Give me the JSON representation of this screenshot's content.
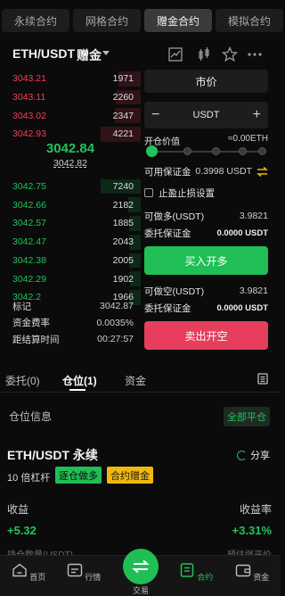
{
  "top_tabs": [
    "永续合约",
    "网格合约",
    "赠金合约",
    "模拟合约"
  ],
  "header": {
    "pair": "ETH/USDT",
    "badge": "赠金"
  },
  "orderbook": {
    "asks": [
      {
        "price": "3043.21",
        "qty": "1971",
        "depth": 0.55
      },
      {
        "price": "3043.11",
        "qty": "2260",
        "depth": 0.62
      },
      {
        "price": "3043.02",
        "qty": "2347",
        "depth": 0.65
      },
      {
        "price": "3042.93",
        "qty": "4221",
        "depth": 1.0
      }
    ],
    "mid": {
      "price": "3042.84",
      "mark": "3042.82"
    },
    "bids": [
      {
        "price": "3042.75",
        "qty": "7240",
        "depth": 1.0
      },
      {
        "price": "3042.66",
        "qty": "2182",
        "depth": 0.32
      },
      {
        "price": "3042.57",
        "qty": "1885",
        "depth": 0.28
      },
      {
        "price": "3042.47",
        "qty": "2043",
        "depth": 0.3
      },
      {
        "price": "3042.38",
        "qty": "2005",
        "depth": 0.29
      },
      {
        "price": "3042.29",
        "qty": "1902",
        "depth": 0.27
      },
      {
        "price": "3042.2",
        "qty": "1966",
        "depth": 0.28
      }
    ]
  },
  "stats": [
    {
      "label": "标记",
      "value": "3042.87"
    },
    {
      "label": "资金费率",
      "value": "0.0035%"
    },
    {
      "label": "距结算时间",
      "value": "00:27:57"
    }
  ],
  "form": {
    "order_type": "市价",
    "amount_unit": "USDT",
    "minus": "−",
    "plus": "+",
    "open_value_label": "开仓价值",
    "open_value": "≈0.00ETH",
    "slider_level": 0,
    "avail_label": "可用保证金",
    "avail_value": "0.3998 USDT",
    "tpsl_label": "止盈止损设置",
    "long_label": "可做多(USDT)",
    "long_value": "3.9821",
    "margin_label": "委托保证金",
    "margin_value": "0.0000 USDT",
    "buy_label": "买入开多",
    "short_label": "可做空(USDT)",
    "short_value": "3.9821",
    "margin_label2": "委托保证金",
    "margin_value2": "0.0000 USDT",
    "sell_label": "卖出开空"
  },
  "bottom_tabs": [
    "委托(0)",
    "仓位(1)",
    "资金"
  ],
  "position": {
    "section_title": "仓位信息",
    "close_all": "全部平仓",
    "pair": "ETH/USDT 永续",
    "share": "分享",
    "leverage": "10 倍杠杆",
    "tag_side": "逐仓做多",
    "tag_type": "合约赠金",
    "pnl_label": "收益",
    "pnl_value": "+5.32",
    "roe_label": "收益率",
    "roe_value": "+3.31%",
    "faded_left": "持仓数量(USDT)",
    "faded_right": "预估强平价"
  },
  "nav": [
    {
      "label": "首页",
      "icon": "home-icon"
    },
    {
      "label": "行情",
      "icon": "market-icon"
    },
    {
      "label": "交易",
      "icon": "trade-icon"
    },
    {
      "label": "合约",
      "icon": "futures-icon"
    },
    {
      "label": "资金",
      "icon": "wallet-icon"
    }
  ],
  "colors": {
    "green": "#22c25c",
    "red": "#f0405b",
    "yellow": "#f0b90b"
  }
}
